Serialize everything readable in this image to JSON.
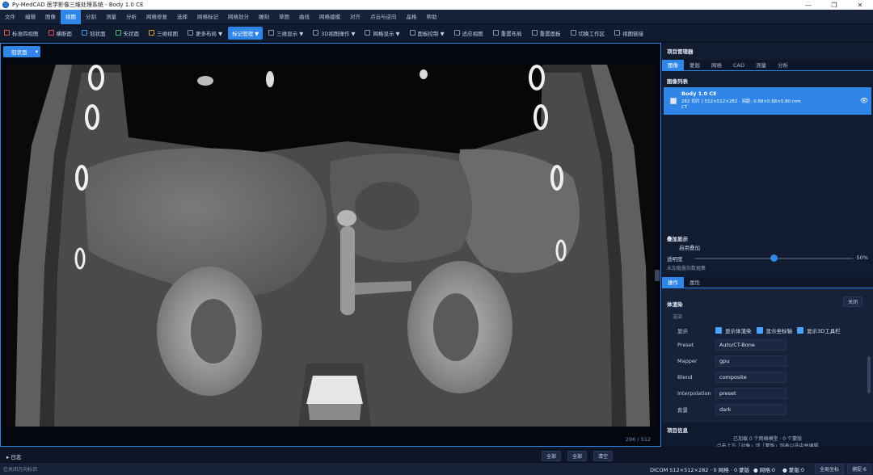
{
  "window": {
    "title": "Py-MedCAD 医学影像三维处理系统 - Body 1.0 CE",
    "minimize": "—",
    "maximize": "❐",
    "close": "✕"
  },
  "menu": [
    "文件",
    "编辑",
    "图像",
    "视图",
    "分割",
    "测量",
    "分析",
    "网格修复",
    "选择",
    "网格标记",
    "网格划分",
    "雕刻",
    "草图",
    "曲线",
    "网格建模",
    "对齐",
    "点云与逆向",
    "晶格",
    "帮助"
  ],
  "menu_active_index": 3,
  "toolbar": [
    {
      "label": "标准四视图",
      "icon": "grid-icon",
      "color": "#e05a4a"
    },
    {
      "label": "横断面",
      "icon": "axial-icon",
      "color": "#e04a4a"
    },
    {
      "label": "冠状面",
      "icon": "coronal-icon",
      "color": "#4a9be0"
    },
    {
      "label": "矢状面",
      "icon": "sagittal-icon",
      "color": "#4ac06a"
    },
    {
      "label": "三维视图",
      "icon": "cube-icon",
      "color": "#e0a04a"
    },
    {
      "label": "更多布局 ▼",
      "icon": "layout-icon",
      "color": "#8a96ad"
    },
    {
      "label": "标记管理 ▼",
      "icon": "",
      "color": "#2f86e8"
    },
    {
      "label": "三维显示 ▼",
      "icon": "display-icon",
      "color": "#8a96ad"
    },
    {
      "label": "3D视图操作 ▼",
      "icon": "rotate-icon",
      "color": "#8a96ad"
    },
    {
      "label": "网格显示 ▼",
      "icon": "mesh-icon",
      "color": "#8a96ad"
    },
    {
      "label": "面板控制 ▼",
      "icon": "panel-icon",
      "color": "#8a96ad"
    },
    {
      "label": "适应视图",
      "icon": "fit-icon",
      "color": "#8a96ad"
    },
    {
      "label": "重置布局",
      "icon": "reset-icon",
      "color": "#8a96ad"
    },
    {
      "label": "重置面板",
      "icon": "reset-panel-icon",
      "color": "#8a96ad"
    },
    {
      "label": "切换工作区",
      "icon": "workspace-icon",
      "color": "#8a96ad"
    },
    {
      "label": "视图链接",
      "icon": "link-icon",
      "color": "#8a96ad"
    }
  ],
  "toolbar_active_index": 6,
  "viewport": {
    "view_select": "冠状面",
    "slice_index": "296 / 512"
  },
  "project": {
    "title": "项目管理器",
    "tabs": [
      "图像",
      "蒙版",
      "网格",
      "CAD",
      "测量",
      "分析"
    ],
    "active_tab": 0,
    "list_title": "图像列表",
    "image": {
      "name": "Body 1.0 CE",
      "info": "282 切片 | 512×512×282 · 间距: 0.68×0.68×0.80 mm",
      "modality": "CT",
      "eye": "👁"
    }
  },
  "overlay": {
    "title": "叠加显示",
    "enable": "启用叠加",
    "opacity_label": "透明度",
    "opacity_value": "50%",
    "opacity": 0.5,
    "note": "未加载叠加数据集"
  },
  "ops": {
    "tabs": [
      "操作",
      "属性"
    ],
    "active_tab": 0,
    "title": "体渲染",
    "close": "关闭",
    "subsection": "渲染",
    "display_label": "显示",
    "checks": [
      "显示体渲染",
      "显示坐标轴",
      "显示3D工具栏"
    ],
    "rows": [
      {
        "label": "Preset",
        "value": "Auto/CT-Bone"
      },
      {
        "label": "Mapper",
        "value": "gpu"
      },
      {
        "label": "Blend",
        "value": "composite"
      },
      {
        "label": "Interpolation",
        "value": "preset"
      },
      {
        "label": "背景",
        "value": "dark"
      }
    ]
  },
  "project_info": {
    "title": "项目信息",
    "line1": "已加载 0 个网格模型 · 0 个蒙版",
    "line2": "点击上方「对象」或「蒙版」列表以选中并编辑"
  },
  "log": {
    "label": "▸ 日志",
    "filter1": "全部",
    "filter2": "全部",
    "clear": "清空"
  },
  "status": {
    "left": "已关闭方向标识",
    "dicom": "DICOM 512×512×282 · 0 网格 · 0 蒙版",
    "mesh_count": "● 网格:0",
    "mask_count": "● 蒙版:0",
    "global": "全局坐标",
    "snap": "捕捉:6"
  }
}
